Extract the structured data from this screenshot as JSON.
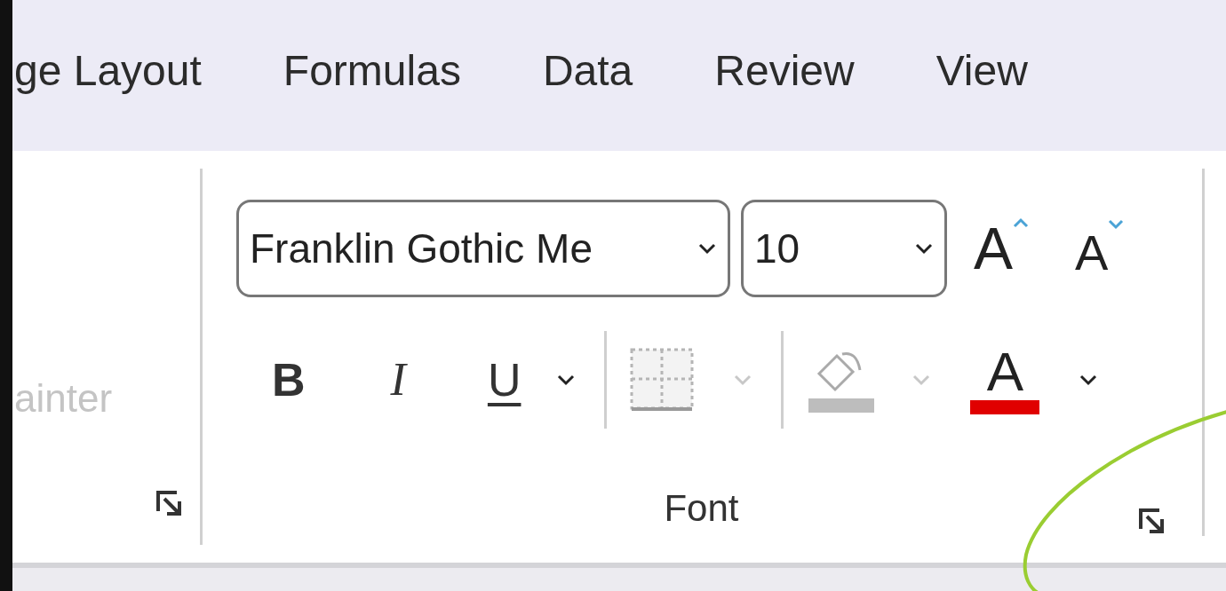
{
  "tabs": [
    {
      "label": "ge Layout"
    },
    {
      "label": "Formulas"
    },
    {
      "label": "Data"
    },
    {
      "label": "Review"
    },
    {
      "label": "View"
    }
  ],
  "clipboard_group": {
    "label_fragment": "ainter",
    "disabled": true
  },
  "font_group": {
    "font_name": "Franklin Gothic Me",
    "font_size": "10",
    "grow_glyph": "A",
    "shrink_glyph": "A",
    "bold": "B",
    "italic": "I",
    "underline": "U",
    "borders_disabled": true,
    "fill_color": {
      "color": "#bdbdbd",
      "disabled": true
    },
    "font_color": {
      "glyph": "A",
      "color": "#e00000",
      "disabled": false
    },
    "label": "Font"
  }
}
